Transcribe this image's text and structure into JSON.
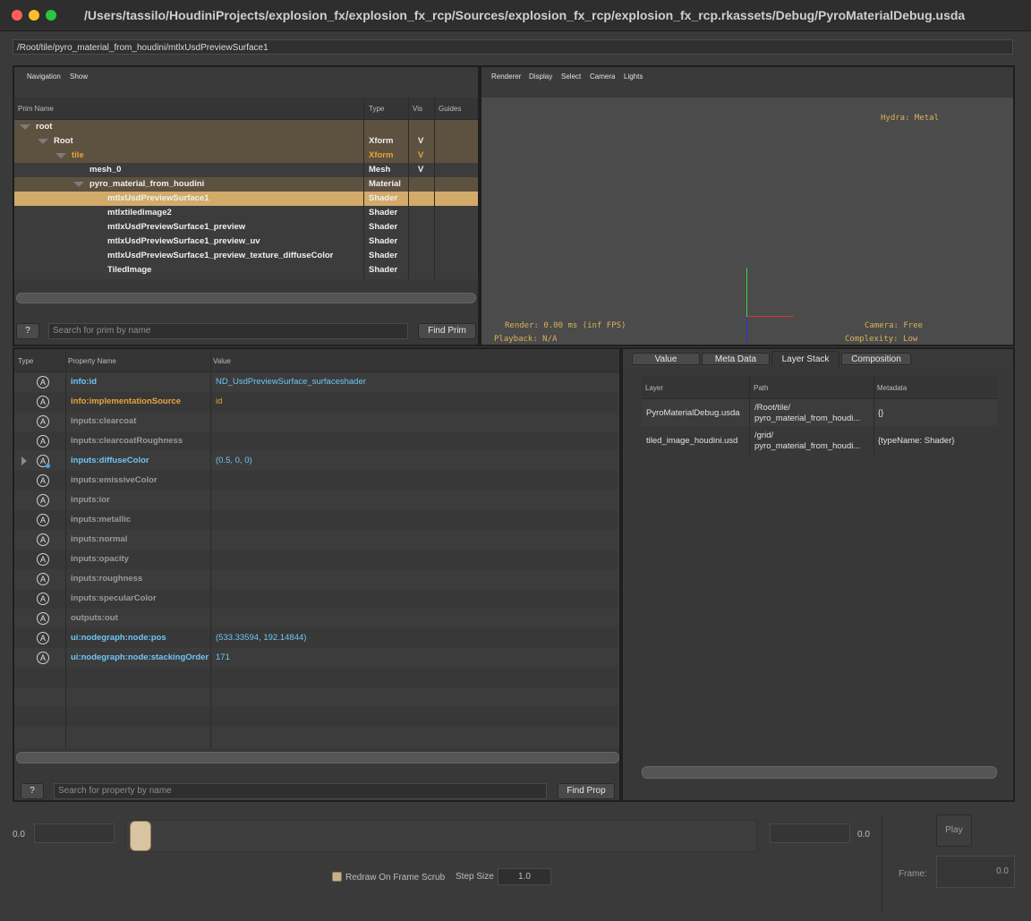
{
  "window": {
    "title": "/Users/tassilo/HoudiniProjects/explosion_fx/explosion_fx_rcp/Sources/explosion_fx_rcp/explosion_fx_rcp.rkassets/Debug/PyroMaterialDebug.usda"
  },
  "path_bar": "/Root/tile/pyro_material_from_houdini/mtlxUsdPreviewSurface1",
  "tree": {
    "menus": [
      "Navigation",
      "Show"
    ],
    "headers": {
      "name": "Prim Name",
      "type": "Type",
      "vis": "Vis",
      "guides": "Guides"
    },
    "rows": [
      {
        "name": "root",
        "type": "",
        "vis": ""
      },
      {
        "name": "Root",
        "type": "Xform",
        "vis": "V"
      },
      {
        "name": "tile",
        "type": "Xform",
        "vis": "V"
      },
      {
        "name": "mesh_0",
        "type": "Mesh",
        "vis": "V"
      },
      {
        "name": "pyro_material_from_houdini",
        "type": "Material",
        "vis": ""
      },
      {
        "name": "mtlxUsdPreviewSurface1",
        "type": "Shader",
        "vis": ""
      },
      {
        "name": "mtlxtiledimage2",
        "type": "Shader",
        "vis": ""
      },
      {
        "name": "mtlxUsdPreviewSurface1_preview",
        "type": "Shader",
        "vis": ""
      },
      {
        "name": "mtlxUsdPreviewSurface1_preview_uv",
        "type": "Shader",
        "vis": ""
      },
      {
        "name": "mtlxUsdPreviewSurface1_preview_texture_diffuseColor",
        "type": "Shader",
        "vis": ""
      },
      {
        "name": "TiledImage",
        "type": "Shader",
        "vis": ""
      }
    ],
    "help_label": "?",
    "search_placeholder": "Search for prim by name",
    "find_label": "Find Prim"
  },
  "viewport": {
    "menus": [
      "Renderer",
      "Display",
      "Select",
      "Camera",
      "Lights"
    ],
    "hydra": "Hydra: Metal",
    "render": "Render: 0.00 ms (inf FPS)",
    "playback": "Playback: N/A",
    "camera": "Camera: Free",
    "complexity": "Complexity: Low"
  },
  "props": {
    "headers": {
      "type": "Type",
      "name": "Property Name",
      "value": "Value"
    },
    "icon_letter": "A",
    "rows": [
      {
        "name": "info:id",
        "value": "ND_UsdPreviewSurface_surfaceshader",
        "style": "authored"
      },
      {
        "name": "info:implementationSource",
        "value": "id",
        "style": "fallback"
      },
      {
        "name": "inputs:clearcoat",
        "value": "",
        "style": "unset"
      },
      {
        "name": "inputs:clearcoatRoughness",
        "value": "",
        "style": "unset"
      },
      {
        "name": "inputs:diffuseColor",
        "value": "(0.5, 0, 0)",
        "style": "authored"
      },
      {
        "name": "inputs:emissiveColor",
        "value": "",
        "style": "unset"
      },
      {
        "name": "inputs:ior",
        "value": "",
        "style": "unset"
      },
      {
        "name": "inputs:metallic",
        "value": "",
        "style": "unset"
      },
      {
        "name": "inputs:normal",
        "value": "",
        "style": "unset"
      },
      {
        "name": "inputs:opacity",
        "value": "",
        "style": "unset"
      },
      {
        "name": "inputs:roughness",
        "value": "",
        "style": "unset"
      },
      {
        "name": "inputs:specularColor",
        "value": "",
        "style": "unset"
      },
      {
        "name": "outputs:out",
        "value": "",
        "style": "unset"
      },
      {
        "name": "ui:nodegraph:node:pos",
        "value": "(533.33594, 192.14844)",
        "style": "authored"
      },
      {
        "name": "ui:nodegraph:node:stackingOrder",
        "value": "171",
        "style": "authored"
      }
    ],
    "help_label": "?",
    "search_placeholder": "Search for property by name",
    "find_label": "Find Prop"
  },
  "info": {
    "tabs": [
      "Value",
      "Meta Data",
      "Layer Stack",
      "Composition"
    ],
    "headers": {
      "layer": "Layer",
      "path": "Path",
      "metadata": "Metadata"
    },
    "rows": [
      {
        "layer": "PyroMaterialDebug.usda",
        "path1": "/Root/tile/",
        "path2": "pyro_material_from_houdi...",
        "metadata": "{}"
      },
      {
        "layer": "tiled_image_houdini.usd",
        "path1": "/grid/",
        "path2": "pyro_material_from_houdi...",
        "metadata": "{typeName: Shader}"
      }
    ]
  },
  "timeline": {
    "start": "0.0",
    "end": "0.0",
    "redraw_label": "Redraw On Frame Scrub",
    "step_label": "Step Size",
    "step_value": "1.0",
    "play_label": "Play",
    "frame_label": "Frame:",
    "frame_value": "0.0"
  },
  "colors": {
    "selection": "#d2aa6a",
    "authored": "#6fc6f5",
    "fallback": "#e8a43a",
    "unset": "#9a9a9a",
    "ancestor_row": "#5d5140"
  }
}
